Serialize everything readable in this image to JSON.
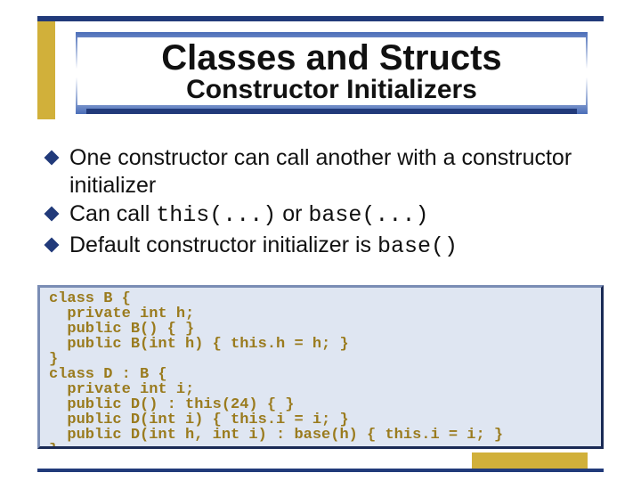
{
  "colors": {
    "navy": "#213a7a",
    "gold": "#d1b03a",
    "code_bg": "#dfe6f2",
    "code_fg": "#9a7b1e"
  },
  "title": "Classes and Structs",
  "subtitle": "Constructor Initializers",
  "bullets": [
    {
      "pre": "One constructor can call another with a constructor initializer",
      "mono": "",
      "post": ""
    },
    {
      "pre": "Can call ",
      "mono": "this(...)",
      "post_pre": " or ",
      "mono2": "base(...)",
      "post": ""
    },
    {
      "pre": "Default constructor initializer is ",
      "mono": "base()",
      "post": ""
    }
  ],
  "code": "class B {\n  private int h;\n  public B() { }\n  public B(int h) { this.h = h; }\n}\nclass D : B {\n  private int i;\n  public D() : this(24) { }\n  public D(int i) { this.i = i; }\n  public D(int h, int i) : base(h) { this.i = i; }\n}"
}
